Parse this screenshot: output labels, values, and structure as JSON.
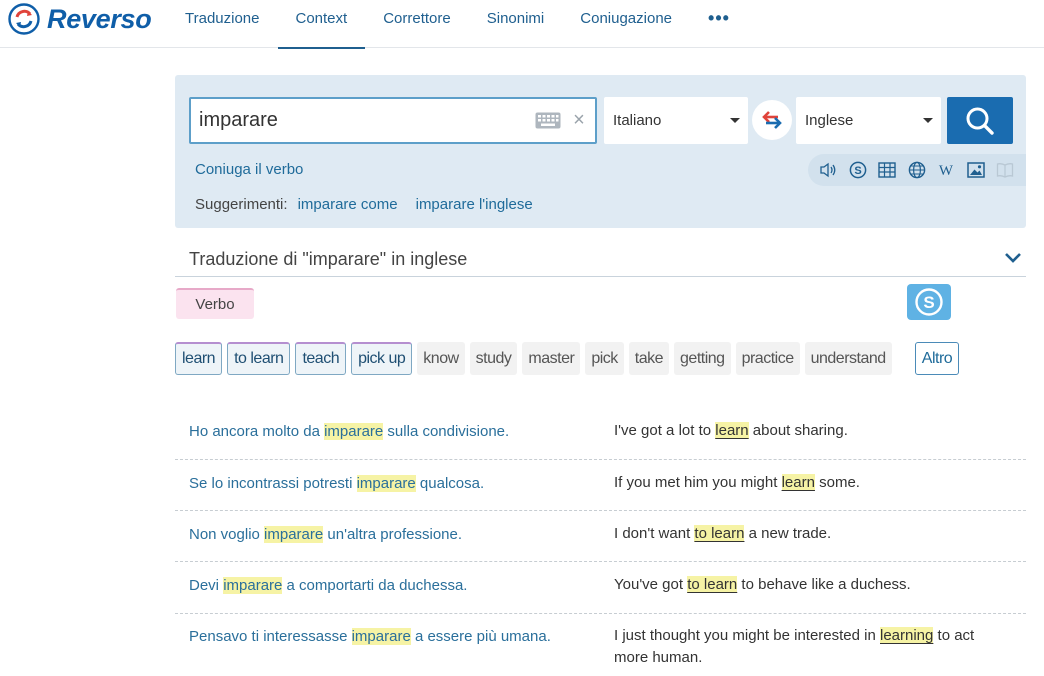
{
  "brand": {
    "name": "Reverso",
    "accent": "#0f5ea8"
  },
  "nav": {
    "items": [
      {
        "label": "Traduzione"
      },
      {
        "label": "Context"
      },
      {
        "label": "Correttore"
      },
      {
        "label": "Sinonimi"
      },
      {
        "label": "Coniugazione"
      }
    ],
    "active": "Context",
    "more_label": "•••"
  },
  "search": {
    "query": "imparare",
    "source_language": "Italiano",
    "target_language": "Inglese",
    "clear_label": "×",
    "conjugate_link": "Coniuga il verbo",
    "suggestions_label": "Suggerimenti:",
    "suggestions": [
      "imparare come",
      "imparare l'inglese"
    ],
    "tools": [
      "speaker-icon",
      "skype-icon",
      "table-icon",
      "globe-icon",
      "wikipedia-icon",
      "image-icon",
      "book-icon"
    ]
  },
  "translation": {
    "title": "Traduzione di \"imparare\" in inglese",
    "pos": "Verbo",
    "main": [
      "learn",
      "to learn",
      "teach",
      "pick up"
    ],
    "other": [
      "know",
      "study",
      "master",
      "pick",
      "take",
      "getting",
      "practice",
      "understand"
    ],
    "more_label": "Altro"
  },
  "examples": [
    {
      "src": [
        "Ho ancora molto da ",
        "imparare",
        " sulla condivisione."
      ],
      "tgt": [
        "I've got a lot to ",
        "learn",
        " about sharing."
      ]
    },
    {
      "src": [
        "Se lo incontrassi potresti ",
        "imparare",
        " qualcosa."
      ],
      "tgt": [
        "If you met him you might ",
        "learn",
        " some."
      ]
    },
    {
      "src": [
        "Non voglio ",
        "imparare",
        " un'altra professione."
      ],
      "tgt": [
        "I don't want ",
        "to learn",
        " a new trade."
      ]
    },
    {
      "src": [
        "Devi ",
        "imparare",
        " a comportarti da duchessa."
      ],
      "tgt": [
        "You've got ",
        "to learn",
        " to behave like a duchess."
      ]
    },
    {
      "src": [
        "Pensavo ti interessasse ",
        "imparare",
        " a essere più umana."
      ],
      "tgt": [
        "I just thought you might be interested in ",
        "learning",
        " to act more human."
      ]
    }
  ],
  "colors": {
    "highlight": "#f6f3a5",
    "panel": "#dfeaf3",
    "search_button": "#1a6cb0",
    "link": "#1f6b9a"
  }
}
